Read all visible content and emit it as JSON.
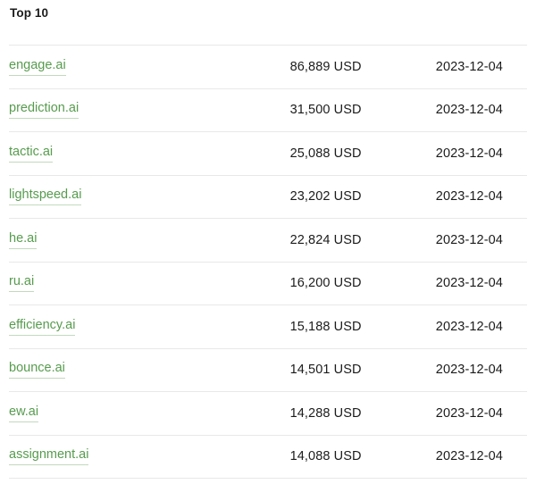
{
  "panel": {
    "title": "Top 10",
    "accent_link_color": "#569c4d",
    "text_color": "#1b1b1b",
    "divider_color": "#e8e8e8",
    "background_color": "#ffffff"
  },
  "table": {
    "columns": [
      {
        "key": "domain",
        "label": ""
      },
      {
        "key": "amount",
        "label": ""
      },
      {
        "key": "date",
        "label": ""
      }
    ],
    "rows": [
      {
        "domain": "engage.ai",
        "amount": "86,889 USD",
        "date": "2023-12-04"
      },
      {
        "domain": "prediction.ai",
        "amount": "31,500 USD",
        "date": "2023-12-04"
      },
      {
        "domain": "tactic.ai",
        "amount": "25,088 USD",
        "date": "2023-12-04"
      },
      {
        "domain": "lightspeed.ai",
        "amount": "23,202 USD",
        "date": "2023-12-04"
      },
      {
        "domain": "he.ai",
        "amount": "22,824 USD",
        "date": "2023-12-04"
      },
      {
        "domain": "ru.ai",
        "amount": "16,200 USD",
        "date": "2023-12-04"
      },
      {
        "domain": "efficiency.ai",
        "amount": "15,188 USD",
        "date": "2023-12-04"
      },
      {
        "domain": "bounce.ai",
        "amount": "14,501 USD",
        "date": "2023-12-04"
      },
      {
        "domain": "ew.ai",
        "amount": "14,288 USD",
        "date": "2023-12-04"
      },
      {
        "domain": "assignment.ai",
        "amount": "14,088 USD",
        "date": "2023-12-04"
      }
    ]
  }
}
